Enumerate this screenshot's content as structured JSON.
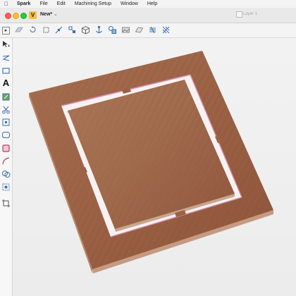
{
  "menubar": {
    "apple": "",
    "app_name": "Spark",
    "items": [
      "File",
      "Edit",
      "Machining Setup",
      "Window",
      "Help"
    ]
  },
  "window": {
    "logo_letter": "V",
    "document_title": "New*",
    "title_chevron": "⌄",
    "layer_label": "Layer 1"
  },
  "left_tools": {
    "text_tool_label": "A"
  },
  "colors": {
    "wood_light": "#a36a4c",
    "wood_dark": "#8a5138",
    "edge": "#b98a6f",
    "cut_highlight": "#d58ca6",
    "accent_icon": "#3a6fb0"
  }
}
